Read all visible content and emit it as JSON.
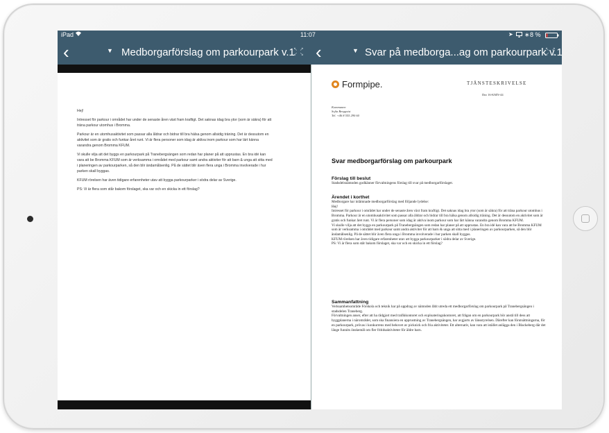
{
  "status_bar": {
    "device": "iPad",
    "time": "11:07",
    "battery": "8 %"
  },
  "left_panel": {
    "title": "Medborgarförslag om parkourpark  v.1",
    "paragraphs": [
      "Hej!",
      "Intresset för parkour i området har under de senaste åren växt fram kraftigt. Det saknas idag bra ytor (som är säkra) för att träna parkour utomhus i Bromma.",
      " Parkour är en utomhusaktivitet som passar alla åldrar och bidrar till bra hälsa genom allsidig träning. Det är dessutom en aktivitet som är gratis och funkar året runt. Vi är flera personer som idag är aktiva inom parkour som har lärt känna varandra genom Bromma KFUM.",
      "Vi skulle vilja att det byggs en parkourpark på Tranebergsängen som redan har planer på att upprustas. En bra idé kan vara att be Bromma KFUM som är verksamma i området med parkour samt andra aktiviter för att barn & unga att sitta med i planeringen av parkourparken, så den blir ändamålsenlig. På de sättet blir även flera unga i Bromma involverade i hur parken skall byggas.",
      "KFUM rörelsen har även tidigare erfarenheter utav att bygga parkourparker i södra delar av Sverige.",
      "PS: Vi är flera som står bakom förslaget, ska var och en skicka in ett förslag?"
    ]
  },
  "right_panel": {
    "title": "Svar på medborga...ag om parkourpark  v.1",
    "logo": "Formpipe.",
    "doc_type": "TJÄNSTESKRIVELSE",
    "doc_number": "Dnr 16-KMN-44",
    "sender": {
      "role": "Kommunen",
      "name": "Sofia Bergqvist",
      "phone": "Tel. +46 8 555 290 60"
    },
    "heading": "Svar medborgarförslag om parkourpark",
    "sections": [
      {
        "title": "Förslag till beslut",
        "body": "Stadsdelsnämnden godkänner förvaltningens förslag till svar på medborgarförslaget."
      },
      {
        "title": "Ärendet i korthet",
        "body": "Medborgare har inlämnade medborgarförslag med följande lydelse:\nHej!\nIntresset för parkour i området har under de senaste åren växt fram kraftigt. Det saknas idag bra ytor (som är säkra) för att träna parkour utomhus i Bromma. Parkour är en utomhusaktivitet som passar alla åldrar och bidrar till bra hälsa genom allsidig träning. Det är dessutom en aktivitet som är gratis och funkar året runt. Vi är flera personer som idag är aktiva inom parkour som har lärt känna varandra genom Bromma KFUM.\nVi skulle vilja att det byggs en parkourpark på Tranebergsängen som redan har planer på att upprustas. En bra idé kan vara att be Bromma KFUM som är verksamma i området med parkour samt andra aktiviter för att barn & unga att sitta med i planeringen av parkourparken, så den blir ändamålsenlig. På de sättet blir även flera unga i Bromma involverade i hur parken skall byggas.\nKFUM rörelsen har även tidigare erfarenheter utav att bygga parkourparker i södra delar av Sverige.\nPS: Vi är flera som står bakom förslaget, ska var och en skicka in ett förslag?"
      },
      {
        "title": "Sammanfattning",
        "body": "Verksamhetsområde Förskola och teknik har på uppdrag av nämnden låtit utreda ett medborgarförslag om parkourpark på Tranebergsängen i stadsdelen Traneberg.\nFörvaltningen anser, efter att ha rådgjort med trafikkontoret och exploateringskontoret, att frågan om en parkourpark bör anstå till dess att byggplanerna i närområdet, som ska finansiera en upprustning av Tranebergsängen, har avgjorts av länsstyrelsen. Därefter kan förutsättningarna, för en parkourpark, prövas i konkurrens med behovet av picknick och fria aktiviteter. Ett alternativ, kan vara att istället anlägga den i Blackeberg där det länge funnits önskemål om fler fritidsaktiviteter för äldre barn."
      }
    ]
  },
  "colors": {
    "nav_bar": "#3d5b6e",
    "logo_accent": "#e0861f",
    "battery_low": "#e53935"
  },
  "icons": [
    "wifi-icon",
    "location-icon",
    "screen-mirror-icon",
    "bluetooth-icon",
    "battery-icon",
    "back-chevron-icon",
    "dropdown-caret-icon",
    "expand-icon"
  ]
}
